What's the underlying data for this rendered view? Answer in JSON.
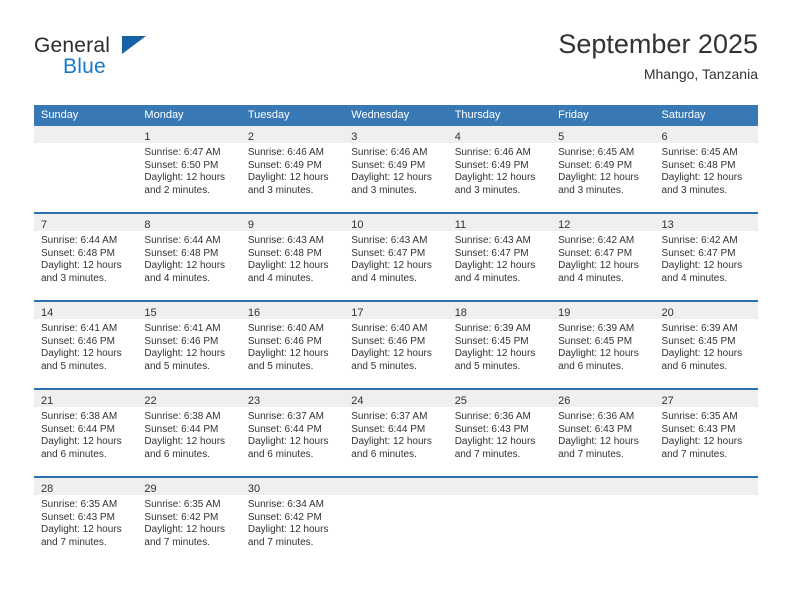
{
  "brand": {
    "name_top": "General",
    "name_bottom": "Blue",
    "triangle_color": "#1464a5",
    "blue_color": "#1b79c9"
  },
  "header": {
    "title": "September 2025",
    "subtitle": "Mhango, Tanzania"
  },
  "theme": {
    "header_blue": "#3878b4",
    "row_divider_blue": "#2f6fad",
    "daynum_band": "#efefef",
    "text": "#333333"
  },
  "weekday_headers": [
    "Sunday",
    "Monday",
    "Tuesday",
    "Wednesday",
    "Thursday",
    "Friday",
    "Saturday"
  ],
  "weeks": [
    [
      {
        "day": "",
        "sunrise": "",
        "sunset": "",
        "daylight_1": "",
        "daylight_2": ""
      },
      {
        "day": "1",
        "sunrise": "Sunrise: 6:47 AM",
        "sunset": "Sunset: 6:50 PM",
        "daylight_1": "Daylight: 12 hours",
        "daylight_2": "and 2 minutes."
      },
      {
        "day": "2",
        "sunrise": "Sunrise: 6:46 AM",
        "sunset": "Sunset: 6:49 PM",
        "daylight_1": "Daylight: 12 hours",
        "daylight_2": "and 3 minutes."
      },
      {
        "day": "3",
        "sunrise": "Sunrise: 6:46 AM",
        "sunset": "Sunset: 6:49 PM",
        "daylight_1": "Daylight: 12 hours",
        "daylight_2": "and 3 minutes."
      },
      {
        "day": "4",
        "sunrise": "Sunrise: 6:46 AM",
        "sunset": "Sunset: 6:49 PM",
        "daylight_1": "Daylight: 12 hours",
        "daylight_2": "and 3 minutes."
      },
      {
        "day": "5",
        "sunrise": "Sunrise: 6:45 AM",
        "sunset": "Sunset: 6:49 PM",
        "daylight_1": "Daylight: 12 hours",
        "daylight_2": "and 3 minutes."
      },
      {
        "day": "6",
        "sunrise": "Sunrise: 6:45 AM",
        "sunset": "Sunset: 6:48 PM",
        "daylight_1": "Daylight: 12 hours",
        "daylight_2": "and 3 minutes."
      }
    ],
    [
      {
        "day": "7",
        "sunrise": "Sunrise: 6:44 AM",
        "sunset": "Sunset: 6:48 PM",
        "daylight_1": "Daylight: 12 hours",
        "daylight_2": "and 3 minutes."
      },
      {
        "day": "8",
        "sunrise": "Sunrise: 6:44 AM",
        "sunset": "Sunset: 6:48 PM",
        "daylight_1": "Daylight: 12 hours",
        "daylight_2": "and 4 minutes."
      },
      {
        "day": "9",
        "sunrise": "Sunrise: 6:43 AM",
        "sunset": "Sunset: 6:48 PM",
        "daylight_1": "Daylight: 12 hours",
        "daylight_2": "and 4 minutes."
      },
      {
        "day": "10",
        "sunrise": "Sunrise: 6:43 AM",
        "sunset": "Sunset: 6:47 PM",
        "daylight_1": "Daylight: 12 hours",
        "daylight_2": "and 4 minutes."
      },
      {
        "day": "11",
        "sunrise": "Sunrise: 6:43 AM",
        "sunset": "Sunset: 6:47 PM",
        "daylight_1": "Daylight: 12 hours",
        "daylight_2": "and 4 minutes."
      },
      {
        "day": "12",
        "sunrise": "Sunrise: 6:42 AM",
        "sunset": "Sunset: 6:47 PM",
        "daylight_1": "Daylight: 12 hours",
        "daylight_2": "and 4 minutes."
      },
      {
        "day": "13",
        "sunrise": "Sunrise: 6:42 AM",
        "sunset": "Sunset: 6:47 PM",
        "daylight_1": "Daylight: 12 hours",
        "daylight_2": "and 4 minutes."
      }
    ],
    [
      {
        "day": "14",
        "sunrise": "Sunrise: 6:41 AM",
        "sunset": "Sunset: 6:46 PM",
        "daylight_1": "Daylight: 12 hours",
        "daylight_2": "and 5 minutes."
      },
      {
        "day": "15",
        "sunrise": "Sunrise: 6:41 AM",
        "sunset": "Sunset: 6:46 PM",
        "daylight_1": "Daylight: 12 hours",
        "daylight_2": "and 5 minutes."
      },
      {
        "day": "16",
        "sunrise": "Sunrise: 6:40 AM",
        "sunset": "Sunset: 6:46 PM",
        "daylight_1": "Daylight: 12 hours",
        "daylight_2": "and 5 minutes."
      },
      {
        "day": "17",
        "sunrise": "Sunrise: 6:40 AM",
        "sunset": "Sunset: 6:46 PM",
        "daylight_1": "Daylight: 12 hours",
        "daylight_2": "and 5 minutes."
      },
      {
        "day": "18",
        "sunrise": "Sunrise: 6:39 AM",
        "sunset": "Sunset: 6:45 PM",
        "daylight_1": "Daylight: 12 hours",
        "daylight_2": "and 5 minutes."
      },
      {
        "day": "19",
        "sunrise": "Sunrise: 6:39 AM",
        "sunset": "Sunset: 6:45 PM",
        "daylight_1": "Daylight: 12 hours",
        "daylight_2": "and 6 minutes."
      },
      {
        "day": "20",
        "sunrise": "Sunrise: 6:39 AM",
        "sunset": "Sunset: 6:45 PM",
        "daylight_1": "Daylight: 12 hours",
        "daylight_2": "and 6 minutes."
      }
    ],
    [
      {
        "day": "21",
        "sunrise": "Sunrise: 6:38 AM",
        "sunset": "Sunset: 6:44 PM",
        "daylight_1": "Daylight: 12 hours",
        "daylight_2": "and 6 minutes."
      },
      {
        "day": "22",
        "sunrise": "Sunrise: 6:38 AM",
        "sunset": "Sunset: 6:44 PM",
        "daylight_1": "Daylight: 12 hours",
        "daylight_2": "and 6 minutes."
      },
      {
        "day": "23",
        "sunrise": "Sunrise: 6:37 AM",
        "sunset": "Sunset: 6:44 PM",
        "daylight_1": "Daylight: 12 hours",
        "daylight_2": "and 6 minutes."
      },
      {
        "day": "24",
        "sunrise": "Sunrise: 6:37 AM",
        "sunset": "Sunset: 6:44 PM",
        "daylight_1": "Daylight: 12 hours",
        "daylight_2": "and 6 minutes."
      },
      {
        "day": "25",
        "sunrise": "Sunrise: 6:36 AM",
        "sunset": "Sunset: 6:43 PM",
        "daylight_1": "Daylight: 12 hours",
        "daylight_2": "and 7 minutes."
      },
      {
        "day": "26",
        "sunrise": "Sunrise: 6:36 AM",
        "sunset": "Sunset: 6:43 PM",
        "daylight_1": "Daylight: 12 hours",
        "daylight_2": "and 7 minutes."
      },
      {
        "day": "27",
        "sunrise": "Sunrise: 6:35 AM",
        "sunset": "Sunset: 6:43 PM",
        "daylight_1": "Daylight: 12 hours",
        "daylight_2": "and 7 minutes."
      }
    ],
    [
      {
        "day": "28",
        "sunrise": "Sunrise: 6:35 AM",
        "sunset": "Sunset: 6:43 PM",
        "daylight_1": "Daylight: 12 hours",
        "daylight_2": "and 7 minutes."
      },
      {
        "day": "29",
        "sunrise": "Sunrise: 6:35 AM",
        "sunset": "Sunset: 6:42 PM",
        "daylight_1": "Daylight: 12 hours",
        "daylight_2": "and 7 minutes."
      },
      {
        "day": "30",
        "sunrise": "Sunrise: 6:34 AM",
        "sunset": "Sunset: 6:42 PM",
        "daylight_1": "Daylight: 12 hours",
        "daylight_2": "and 7 minutes."
      },
      {
        "day": "",
        "sunrise": "",
        "sunset": "",
        "daylight_1": "",
        "daylight_2": ""
      },
      {
        "day": "",
        "sunrise": "",
        "sunset": "",
        "daylight_1": "",
        "daylight_2": ""
      },
      {
        "day": "",
        "sunrise": "",
        "sunset": "",
        "daylight_1": "",
        "daylight_2": ""
      },
      {
        "day": "",
        "sunrise": "",
        "sunset": "",
        "daylight_1": "",
        "daylight_2": ""
      }
    ]
  ]
}
